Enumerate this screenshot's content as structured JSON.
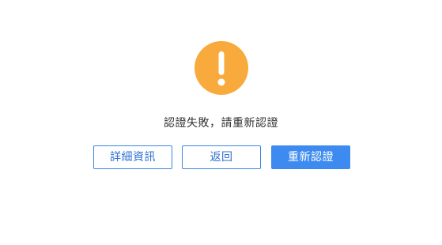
{
  "status": {
    "icon": "warning-icon",
    "icon_color": "#f8ab3c",
    "message": "認證失敗，請重新認證"
  },
  "actions": {
    "details_label": "詳細資訊",
    "back_label": "返回",
    "retry_label": "重新認證"
  },
  "colors": {
    "accent": "#3d8bf0",
    "outline_border": "#3d87e5"
  }
}
